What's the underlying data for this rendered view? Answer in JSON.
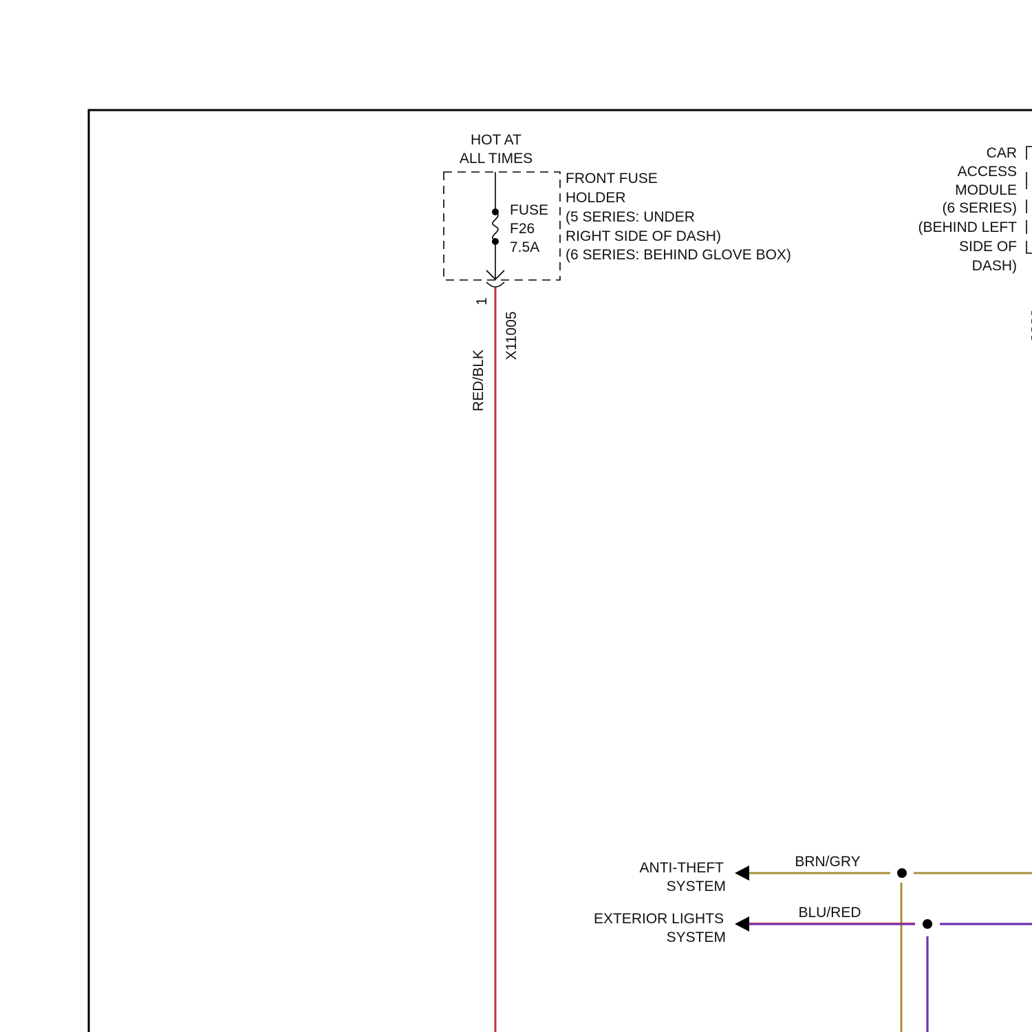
{
  "fuse_block": {
    "hot_label_line1": "HOT AT",
    "hot_label_line2": "ALL TIMES",
    "holder_lines": [
      "FRONT FUSE",
      "HOLDER",
      "(5 SERIES: UNDER",
      "RIGHT SIDE OF DASH)",
      "(6 SERIES: BEHIND GLOVE BOX)"
    ],
    "fuse_lines": [
      "FUSE",
      "F26",
      "7.5A"
    ],
    "pin": "1",
    "connector": "X11005"
  },
  "wires": {
    "main_feed": {
      "label": "RED/BLK",
      "color": "#c0302e"
    },
    "anti_theft": {
      "label": "BRN/GRY",
      "color": "#a8903a"
    },
    "exterior_lights": {
      "label": "BLU/RED",
      "color": "#6a2fb2",
      "stripe": "#e04060"
    }
  },
  "car_access_module": {
    "lines": [
      "CAR",
      "ACCESS",
      "MODULE",
      "(6 SERIES)",
      "(BEHIND LEFT",
      "SIDE OF",
      "DASH)"
    ]
  },
  "destinations": {
    "anti_theft": [
      "ANTI-THEFT",
      "SYSTEM"
    ],
    "exterior_lights": [
      "EXTERIOR LIGHTS",
      "SYSTEM"
    ]
  }
}
